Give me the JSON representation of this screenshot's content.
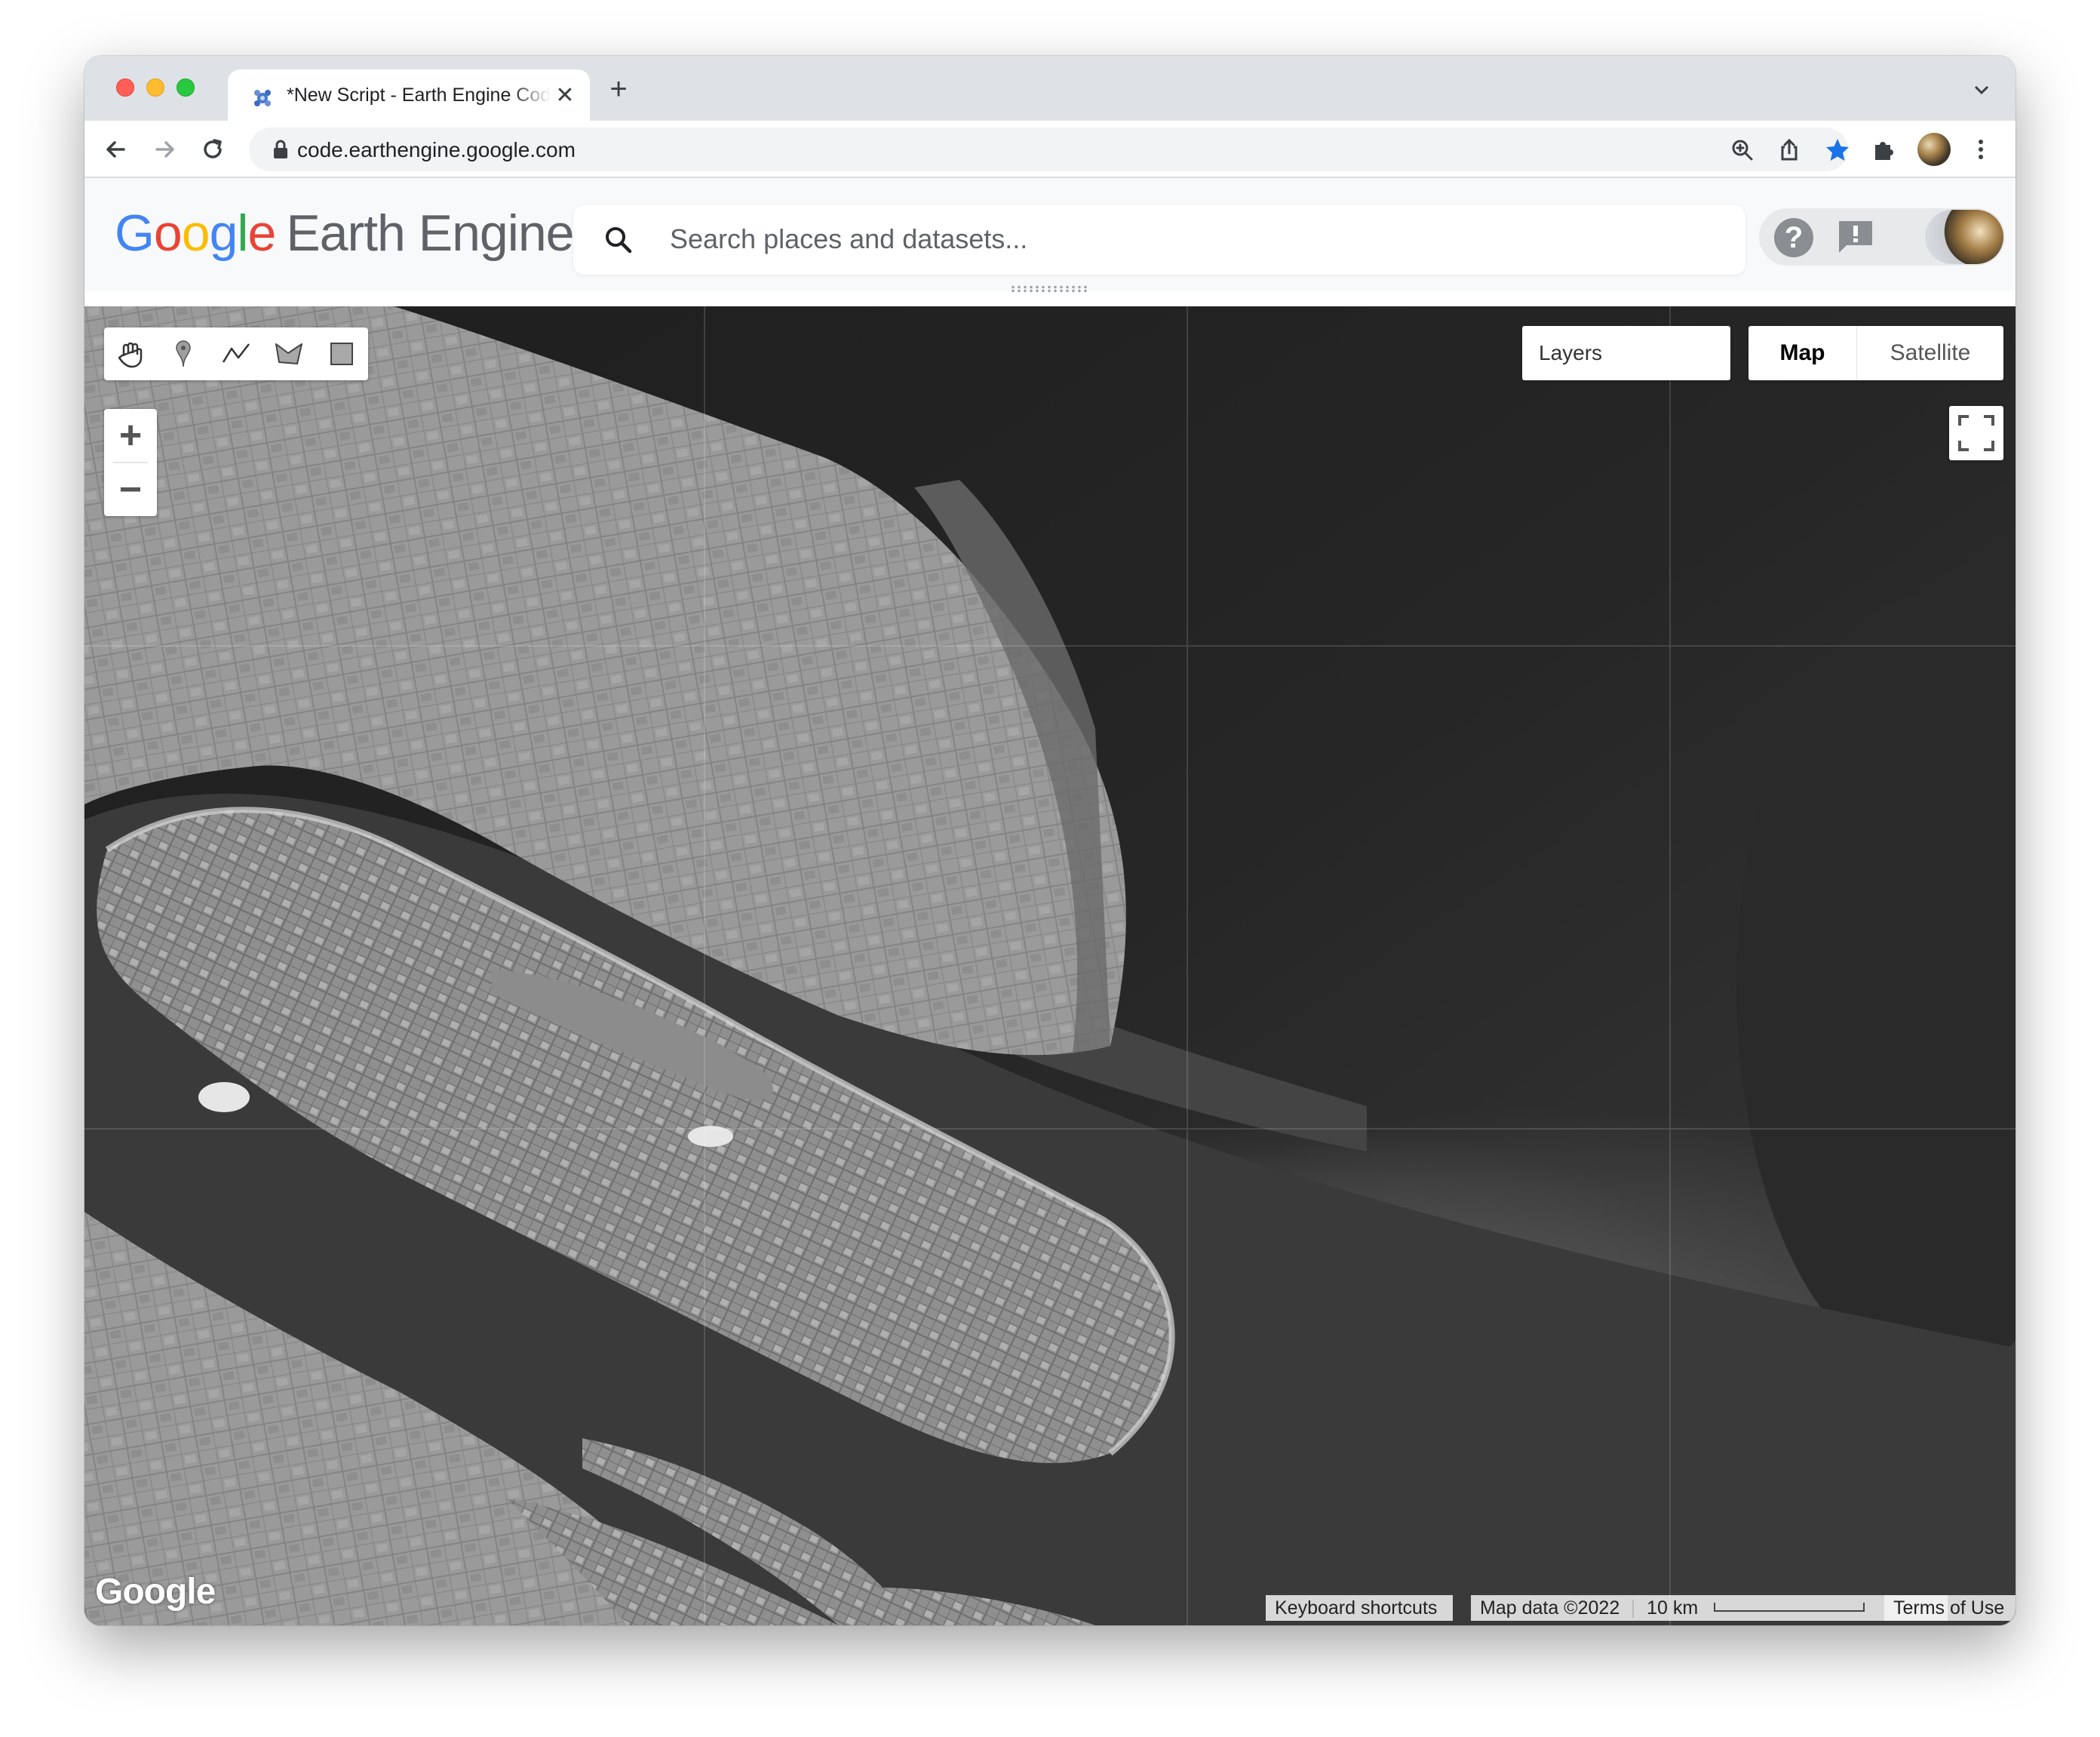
{
  "browser": {
    "tab_title": "*New Script - Earth Engine Code Editor",
    "tab_close": "✕",
    "new_tab": "+",
    "url": "code.earthengine.google.com"
  },
  "header": {
    "logo_google": [
      "G",
      "o",
      "o",
      "g",
      "l",
      "e"
    ],
    "logo_product": "Earth Engine",
    "search_placeholder": "Search places and datasets...",
    "help_label": "?"
  },
  "map": {
    "zoom_in": "+",
    "zoom_out": "−",
    "layers_label": "Layers",
    "map_type": {
      "map": "Map",
      "satellite": "Satellite",
      "selected": "Map"
    },
    "watermark": "Google",
    "footer": {
      "keyboard_shortcuts": "Keyboard shortcuts",
      "map_data": "Map data ©2022",
      "scale_label": "10 km",
      "terms": "Terms of Use"
    }
  },
  "drawing_tools": [
    "hand-icon",
    "marker-icon",
    "line-icon",
    "polygon-icon",
    "rectangle-icon"
  ]
}
